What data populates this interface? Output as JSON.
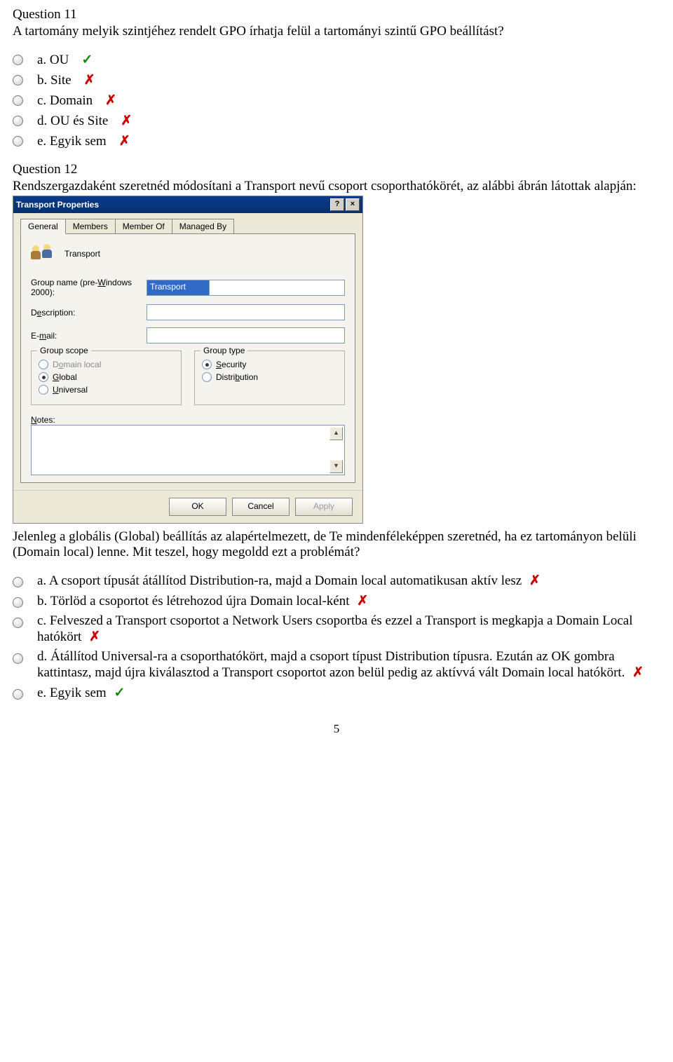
{
  "q11": {
    "title": "Question 11",
    "text": "A tartomány melyik szintjéhez rendelt GPO írhatja felül a tartományi szintű GPO beállítást?",
    "options": [
      {
        "label": "a. OU",
        "correct": true
      },
      {
        "label": "b. Site",
        "correct": false
      },
      {
        "label": "c. Domain",
        "correct": false
      },
      {
        "label": "d. OU és Site",
        "correct": false
      },
      {
        "label": "e. Egyik sem",
        "correct": false
      }
    ]
  },
  "q12": {
    "title": "Question 12",
    "text": "Rendszergazdaként szeretnéd módosítani a Transport nevű csoport csoporthatókörét, az alábbi ábrán látottak alapján:",
    "after_text": "Jelenleg a globális (Global) beállítás az alapértelmezett, de Te mindenféleképpen szeretnéd, ha ez tartományon belüli (Domain local) lenne. Mit teszel, hogy megoldd ezt a problémát?",
    "options": [
      {
        "label": "a. A csoport típusát átállítod Distribution-ra, majd a Domain local automatikusan aktív lesz",
        "correct": false
      },
      {
        "label": "b. Törlöd a csoportot és létrehozod újra Domain local-ként",
        "correct": false
      },
      {
        "label": "c. Felveszed a Transport csoportot a Network Users csoportba és ezzel a Transport is megkapja a Domain Local hatókört",
        "correct": false
      },
      {
        "label": "d. Átállítod Universal-ra a csoporthatókört, majd a csoport típust Distribution típusra. Ezután az OK gombra kattintasz, majd újra kiválasztod a Transport csoportot azon belül pedig az aktívvá vált Domain local hatókört.",
        "correct": false
      },
      {
        "label": "e. Egyik sem",
        "correct": true
      }
    ]
  },
  "dialog": {
    "title": "Transport Properties",
    "tabs": [
      "General",
      "Members",
      "Member Of",
      "Managed By"
    ],
    "group_name_display": "Transport",
    "label_groupname": "Group name (pre-Windows 2000):",
    "groupname_value": "Transport",
    "label_description": "Description:",
    "label_email": "E-mail:",
    "scope_legend": "Group scope",
    "scope_opts": {
      "domain_local": "Domain local",
      "global": "Global",
      "universal": "Universal"
    },
    "type_legend": "Group type",
    "type_opts": {
      "security": "Security",
      "distribution": "Distribution"
    },
    "label_notes": "Notes:",
    "btn_ok": "OK",
    "btn_cancel": "Cancel",
    "btn_apply": "Apply",
    "help_btn": "?",
    "close_btn": "×"
  },
  "page_number": "5",
  "marks": {
    "check": "✓",
    "cross": "✗"
  }
}
